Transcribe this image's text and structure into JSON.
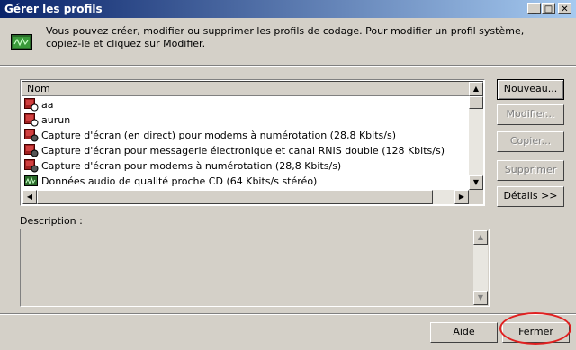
{
  "window": {
    "title": "Gérer les profils",
    "controls": {
      "minimize": "_",
      "maximize": "□",
      "close": "✕"
    }
  },
  "header": {
    "text": "Vous pouvez créer, modifier ou supprimer les profils de codage. Pour modifier un profil système, copiez-le et cliquez sur Modifier.",
    "icon": "profile-meter-icon"
  },
  "profile_list": {
    "column_header": "Nom",
    "items": [
      {
        "label": "aa",
        "icon": "custom-profile-icon"
      },
      {
        "label": "aurun",
        "icon": "custom-profile-icon"
      },
      {
        "label": "Capture d'écran (en direct) pour modems à numérotation (28,8 Kbits/s)",
        "icon": "system-profile-icon"
      },
      {
        "label": "Capture d'écran pour messagerie électronique et canal RNIS double (128 Kbits/s)",
        "icon": "system-profile-icon"
      },
      {
        "label": "Capture d'écran pour modems à numérotation (28,8 Kbits/s)",
        "icon": "system-profile-icon"
      },
      {
        "label": "Données audio de qualité proche CD (64 Kbits/s stéréo)",
        "icon": "audio-profile-icon"
      }
    ]
  },
  "actions": {
    "new": "Nouveau...",
    "edit": "Modifier...",
    "copy": "Copier...",
    "delete": "Supprimer",
    "details": "Détails >>"
  },
  "description": {
    "label": "Description :",
    "value": ""
  },
  "footer": {
    "help": "Aide",
    "close": "Fermer"
  },
  "colors": {
    "titlebar_start": "#0a246a",
    "titlebar_end": "#a6caf0",
    "highlight_circle": "#e02020",
    "face": "#d4d0c8"
  }
}
